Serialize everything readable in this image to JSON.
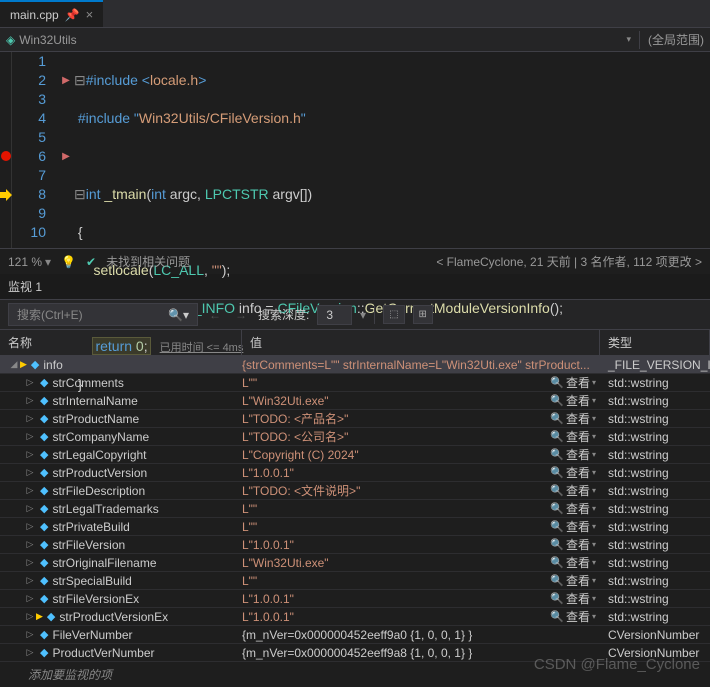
{
  "tab": {
    "name": "main.cpp"
  },
  "navbar": {
    "namespace": "Win32Utils",
    "scope": "(全局范围)"
  },
  "code": {
    "lines": [
      "1",
      "2",
      "3",
      "4",
      "5",
      "6",
      "7",
      "8",
      "9",
      "10"
    ],
    "include1_pre": "#include <",
    "include1_h": "locale.h",
    "include1_post": ">",
    "include2_pre": "#include \"",
    "include2_h": "Win32Utils/CFileVersion.h",
    "include2_post": "\"",
    "int": "int",
    "tmain": "_tmain",
    "args": "(",
    "argc_t": "int",
    "argc": " argc, ",
    "argv_t": "LPCTSTR",
    "argv": " argv[])",
    "setlocale": "setlocale",
    "lcall": "LC_ALL",
    "empty": "\"\"",
    "fvi": "FILE_VERSION_INFO",
    "info": " info = ",
    "cfv": "CFileVersion",
    "gcmvi": "GetCurrentModuleVersionInfo",
    "return": "return",
    "zero": "0",
    "tip": "已用时间 <= 4ms"
  },
  "status": {
    "zoom": "121 %",
    "issues": "未找到相关问题",
    "blame": "FlameCyclone, 21 天前 | 3 名作者, 112 项更改"
  },
  "watch": {
    "title": "监视 1",
    "search_ph": "搜索(Ctrl+E)",
    "depth_lbl": "搜索深度:",
    "depth": "3",
    "cols": {
      "name": "名称",
      "value": "值",
      "type": "类型"
    },
    "view": "查看",
    "add": "添加要监视的项",
    "rows": [
      {
        "d": 0,
        "exp": true,
        "arrow": true,
        "name": "info",
        "val": "{strComments=L\"\" strInternalName=L\"Win32Uti.exe\" strProduct...",
        "type": "_FILE_VERSION_IN",
        "plain": false,
        "mag": false
      },
      {
        "d": 1,
        "exp": false,
        "name": "strComments",
        "val": "L\"\"",
        "type": "std::wstring",
        "mag": true
      },
      {
        "d": 1,
        "exp": false,
        "name": "strInternalName",
        "val": "L\"Win32Uti.exe\"",
        "type": "std::wstring",
        "mag": true
      },
      {
        "d": 1,
        "exp": false,
        "name": "strProductName",
        "val": "L\"TODO: <产品名>\"",
        "type": "std::wstring",
        "mag": true
      },
      {
        "d": 1,
        "exp": false,
        "name": "strCompanyName",
        "val": "L\"TODO: <公司名>\"",
        "type": "std::wstring",
        "mag": true
      },
      {
        "d": 1,
        "exp": false,
        "name": "strLegalCopyright",
        "val": "L\"Copyright (C) 2024\"",
        "type": "std::wstring",
        "mag": true
      },
      {
        "d": 1,
        "exp": false,
        "name": "strProductVersion",
        "val": "L\"1.0.0.1\"",
        "type": "std::wstring",
        "mag": true
      },
      {
        "d": 1,
        "exp": false,
        "name": "strFileDescription",
        "val": "L\"TODO: <文件说明>\"",
        "type": "std::wstring",
        "mag": true
      },
      {
        "d": 1,
        "exp": false,
        "name": "strLegalTrademarks",
        "val": "L\"\"",
        "type": "std::wstring",
        "mag": true
      },
      {
        "d": 1,
        "exp": false,
        "name": "strPrivateBuild",
        "val": "L\"\"",
        "type": "std::wstring",
        "mag": true
      },
      {
        "d": 1,
        "exp": false,
        "name": "strFileVersion",
        "val": "L\"1.0.0.1\"",
        "type": "std::wstring",
        "mag": true
      },
      {
        "d": 1,
        "exp": false,
        "name": "strOriginalFilename",
        "val": "L\"Win32Uti.exe\"",
        "type": "std::wstring",
        "mag": true
      },
      {
        "d": 1,
        "exp": false,
        "name": "strSpecialBuild",
        "val": "L\"\"",
        "type": "std::wstring",
        "mag": true
      },
      {
        "d": 1,
        "exp": false,
        "name": "strFileVersionEx",
        "val": "L\"1.0.0.1\"",
        "type": "std::wstring",
        "mag": true
      },
      {
        "d": 1,
        "exp": false,
        "arrow": true,
        "name": "strProductVersionEx",
        "val": "L\"1.0.0.1\"",
        "type": "std::wstring",
        "mag": true
      },
      {
        "d": 1,
        "exp": false,
        "name": "FileVerNumber",
        "val": "{m_nVer=0x000000452eeff9a0 {1, 0, 0, 1} }",
        "type": "CVersionNumber",
        "plain": true,
        "mag": false
      },
      {
        "d": 1,
        "exp": false,
        "name": "ProductVerNumber",
        "val": "{m_nVer=0x000000452eeff9a8 {1, 0, 0, 1} }",
        "type": "CVersionNumber",
        "plain": true,
        "mag": false
      }
    ]
  },
  "watermark": "CSDN @Flame_Cyclone"
}
